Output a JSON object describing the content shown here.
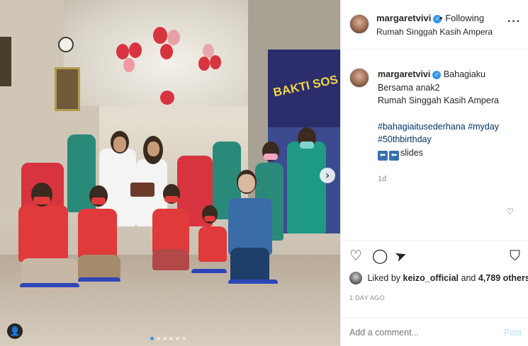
{
  "header": {
    "username": "margaretvivi",
    "separator": "•",
    "following_label": "Following",
    "location": "Rumah Singgah Kasih Ampera",
    "more_icon": "···"
  },
  "photo": {
    "banner_text": "BAKTI SOS",
    "next_arrow": "›",
    "user_tag_icon": "👤",
    "carousel_count": 6,
    "carousel_active_index": 0
  },
  "caption": {
    "username": "margaretvivi",
    "first_line": "Bahagiaku",
    "line2": "Bersama anak2",
    "line3": "Rumah Singgah Kasih Ampera",
    "hashtags_line1": "#bahagiaitusederhana #myday",
    "hashtags_line2": "#50thbirthday",
    "slides_arrows": "⬅⬅",
    "slides_text": "slides",
    "time_ago": "1d"
  },
  "actions": {
    "like_icon": "♡",
    "comment_icon": "◯",
    "share_icon": "➤",
    "save_icon": "⛉",
    "comment_like_icon": "♡"
  },
  "likes": {
    "prefix": "Liked by",
    "user": "keizo_official",
    "middle": "and",
    "count": "4,789 others"
  },
  "date": "1 DAY AGO",
  "comment": {
    "placeholder": "Add a comment...",
    "post_label": "Post"
  },
  "colors": {
    "verified": "#3897f0",
    "hashtag": "#003569",
    "muted": "#8e8e8e",
    "post_disabled": "#b2dffc"
  }
}
